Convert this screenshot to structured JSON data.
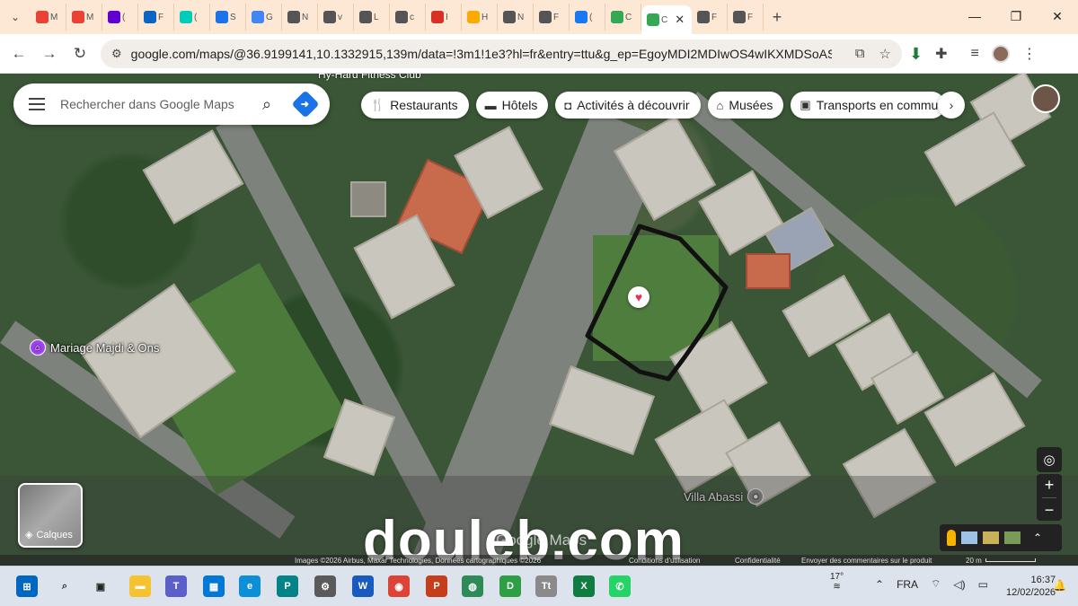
{
  "browser": {
    "tabs": [
      {
        "label": "M",
        "favicon": "gmail-icon",
        "color": "#ea4335"
      },
      {
        "label": "M",
        "favicon": "gmail-icon",
        "color": "#ea4335"
      },
      {
        "label": "(",
        "favicon": "yahoo-mail-icon",
        "color": "#6001d2"
      },
      {
        "label": "F",
        "favicon": "linkedin-icon",
        "color": "#0a66c2"
      },
      {
        "label": "(",
        "favicon": "researchgate-icon",
        "color": "#00ccbb"
      },
      {
        "label": "S",
        "favicon": "grid-app-icon",
        "color": "#1a73e8"
      },
      {
        "label": "G",
        "favicon": "google-icon",
        "color": "#4285f4"
      },
      {
        "label": "N",
        "favicon": "globe-icon",
        "color": "#555555"
      },
      {
        "label": "v",
        "favicon": "globe-icon",
        "color": "#555555"
      },
      {
        "label": "L",
        "favicon": "web-icon",
        "color": "#555555"
      },
      {
        "label": "c",
        "favicon": "globe-icon",
        "color": "#555555"
      },
      {
        "label": "I",
        "favicon": "cart-icon",
        "color": "#d93025"
      },
      {
        "label": "H",
        "favicon": "badge-icon",
        "color": "#f9ab00"
      },
      {
        "label": "N",
        "favicon": "globe-icon",
        "color": "#555555"
      },
      {
        "label": "F",
        "favicon": "globe-icon",
        "color": "#555555"
      },
      {
        "label": "(",
        "favicon": "facebook-icon",
        "color": "#1877f2"
      },
      {
        "label": "C",
        "favicon": "maps-icon",
        "color": "#34a853"
      }
    ],
    "active_tab": {
      "label": "C",
      "favicon": "maps-icon"
    },
    "tabs_after": [
      {
        "label": "F",
        "favicon": "globe-icon",
        "color": "#555555"
      },
      {
        "label": "F",
        "favicon": "globe-icon",
        "color": "#555555"
      }
    ],
    "url": "google.com/maps/@36.9199141,10.1332915,139m/data=!3m1!1e3?hl=fr&entry=ttu&g_ep=EgoyMDI2MDIwOS4wIKXMDSoASAFQA..."
  },
  "maps": {
    "search_placeholder": "Rechercher dans Google Maps",
    "top_clipped_label": "Hy-Hard Fitness Club",
    "chips": [
      {
        "label": "Restaurants",
        "icon": "fork-knife-icon"
      },
      {
        "label": "Hôtels",
        "icon": "bed-icon"
      },
      {
        "label": "Activités à découvrir",
        "icon": "camera-icon"
      },
      {
        "label": "Musées",
        "icon": "museum-icon"
      },
      {
        "label": "Transports en commun",
        "icon": "transit-icon"
      }
    ],
    "pois": [
      {
        "label": "Mariage Majdi & Ons"
      },
      {
        "label": "Villa Abassi"
      }
    ],
    "layers_label": "Calques",
    "watermark": "douleb.com",
    "google_logo": "Google Maps",
    "footer": {
      "attribution": "Images ©2026 Airbus, Maxar Technologies, Données cartographiques ©2026",
      "conditions": "Conditions d'utilisation",
      "privacy": "Confidentialité",
      "feedback": "Envoyer des commentaires sur le produit",
      "scale": "20 m"
    }
  },
  "taskbar": {
    "apps": [
      {
        "name": "start-icon",
        "color": "#0067c0",
        "glyph": "⊞"
      },
      {
        "name": "search-icon",
        "color": "#333333",
        "glyph": "⌕"
      },
      {
        "name": "task-view-icon",
        "color": "#222222",
        "glyph": "▣"
      },
      {
        "name": "file-explorer-icon",
        "color": "#f4c430",
        "glyph": "▬"
      },
      {
        "name": "teams-icon",
        "color": "#5b5fc7",
        "glyph": "T"
      },
      {
        "name": "store-icon",
        "color": "#0078d4",
        "glyph": "▦"
      },
      {
        "name": "edge-icon",
        "color": "#0c8fd6",
        "glyph": "e"
      },
      {
        "name": "publisher-icon",
        "color": "#038387",
        "glyph": "P"
      },
      {
        "name": "settings-icon",
        "color": "#5a5a5a",
        "glyph": "⚙"
      },
      {
        "name": "word-icon",
        "color": "#185abd",
        "glyph": "W"
      },
      {
        "name": "chrome-icon",
        "color": "#db4437",
        "glyph": "◉"
      },
      {
        "name": "powerpoint-icon",
        "color": "#c43e1c",
        "glyph": "P"
      },
      {
        "name": "globe-app-icon",
        "color": "#2e8b57",
        "glyph": "◍"
      },
      {
        "name": "app-d-icon",
        "color": "#2f9e44",
        "glyph": "D"
      },
      {
        "name": "font-app-icon",
        "color": "#8a8a8a",
        "glyph": "Tt"
      },
      {
        "name": "excel-icon",
        "color": "#107c41",
        "glyph": "X"
      },
      {
        "name": "whatsapp-icon",
        "color": "#25d366",
        "glyph": "✆"
      }
    ],
    "weather_temp": "17°",
    "language": "FRA",
    "time": "16:37",
    "date": "12/02/2026"
  }
}
